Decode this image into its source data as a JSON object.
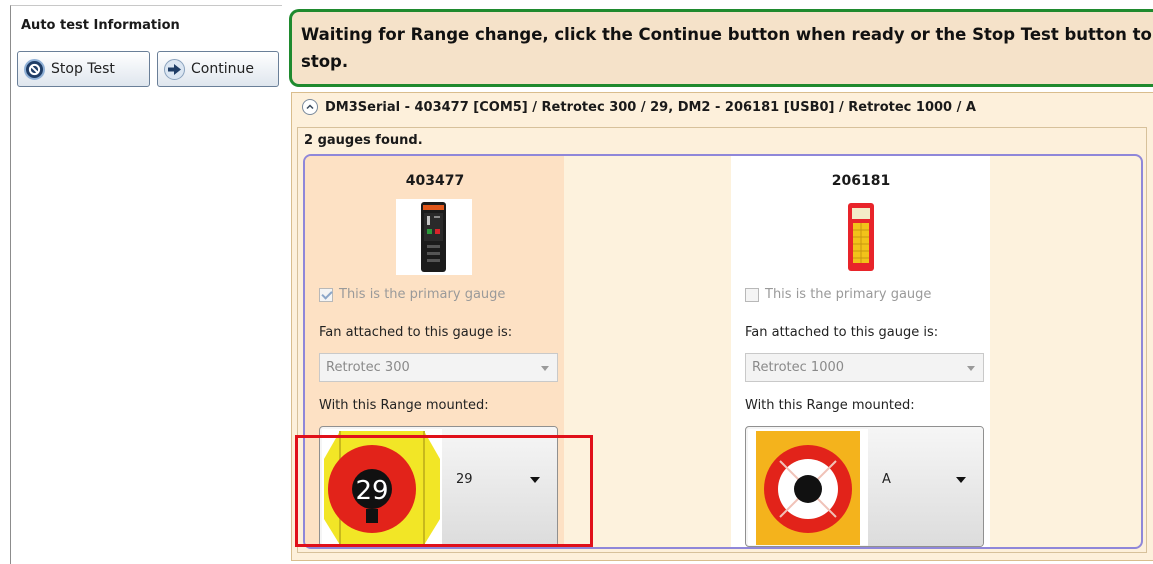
{
  "sidebar": {
    "title": "Auto test Information",
    "stop_label": "Stop Test",
    "continue_label": "Continue"
  },
  "banner": {
    "line1": "Waiting for Range change, click the Continue button when ready or the Stop Test button to",
    "line2": "stop."
  },
  "device_panel": {
    "header": "DM3Serial - 403477 [COM5] / Retrotec 300 / 29, DM2 - 206181 [USB0] / Retrotec 1000 / A",
    "found_text": "2 gauges found."
  },
  "gauges": [
    {
      "serial": "403477",
      "primary_label": "This is the primary gauge",
      "primary_checked": true,
      "fan_label": "Fan attached to this gauge is:",
      "fan_value": "Retrotec 300",
      "range_label": "With this Range mounted:",
      "range_value": "29",
      "range_plate_text": "29",
      "device_icon": "dm3-gauge-icon",
      "range_icon": "range-29-plate-icon"
    },
    {
      "serial": "206181",
      "primary_label": "This is the primary gauge",
      "primary_checked": false,
      "fan_label": "Fan attached to this gauge is:",
      "fan_value": "Retrotec 1000",
      "range_label": "With this Range mounted:",
      "range_value": "A",
      "device_icon": "dm2-gauge-icon",
      "range_icon": "range-a-ring-icon"
    }
  ],
  "colors": {
    "banner_bg": "#f5e2c9",
    "banner_border": "#1f8a2e",
    "panel_bg": "#fdf0db",
    "selected_column": "#fde1c4",
    "gauge_border": "#8f87d9",
    "highlight_box": "#e0101a"
  }
}
